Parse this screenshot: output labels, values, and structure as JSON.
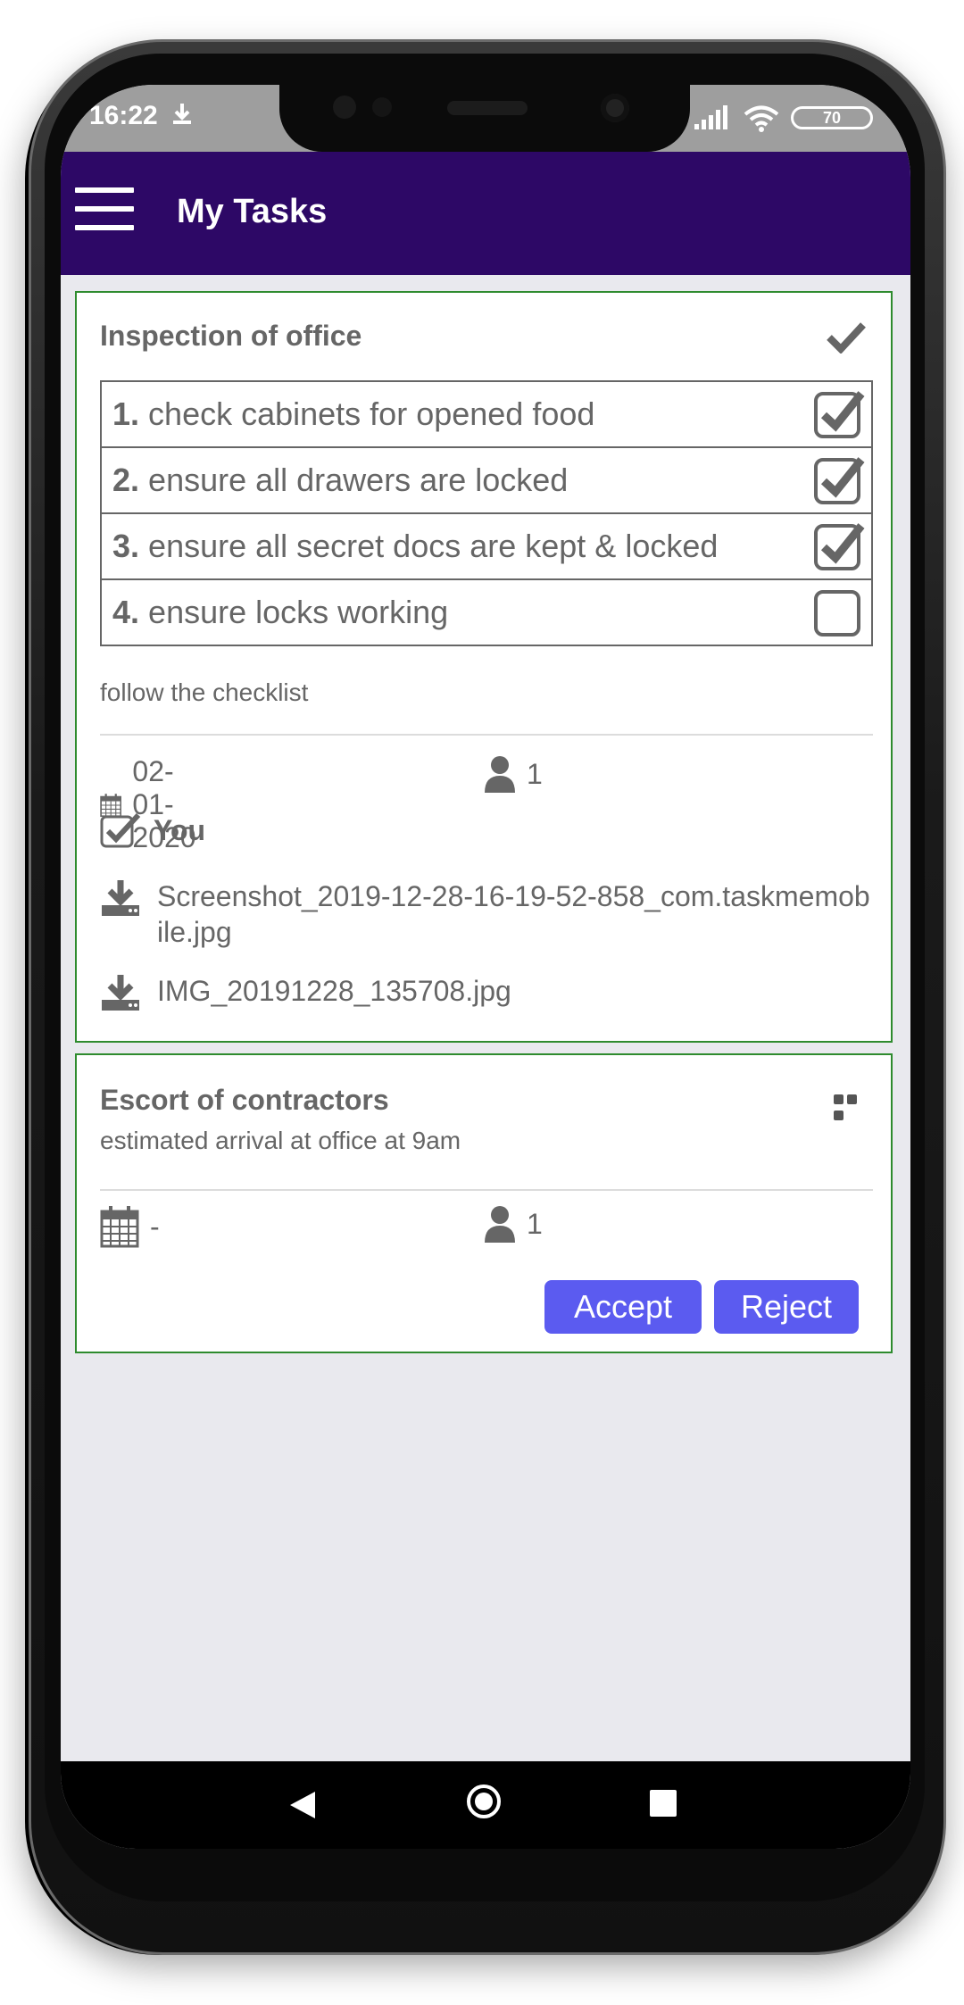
{
  "status_bar": {
    "time": "16:22",
    "battery": "70",
    "icons": [
      "download-icon",
      "signal-icon",
      "wifi-icon",
      "battery-icon"
    ]
  },
  "app_bar": {
    "title": "My Tasks",
    "background": "#2d0866"
  },
  "tasks": [
    {
      "title": "Inspection of office",
      "status_icon": "checkmark-icon",
      "checklist": [
        {
          "number": "1.",
          "text": "check cabinets for opened food",
          "checked": true
        },
        {
          "number": "2.",
          "text": "ensure all drawers are locked",
          "checked": true
        },
        {
          "number": "3.",
          "text": "ensure all secret docs are kept & locked",
          "checked": true
        },
        {
          "number": "4.",
          "text": "ensure locks working",
          "checked": false
        }
      ],
      "note": "follow the checklist",
      "date": "02-01-2020",
      "people": "1",
      "assignee": "You",
      "attachments": [
        {
          "name": "Screenshot_2019-12-28-16-19-52-858_com.taskmemobile.jpg"
        },
        {
          "name": "IMG_20191228_135708.jpg"
        }
      ],
      "border_color": "#2e8b2e"
    },
    {
      "title": "Escort of contractors",
      "status_icon": "more-icon",
      "description": "estimated arrival at office at 9am",
      "date": "-",
      "people": "1",
      "accept_label": "Accept",
      "reject_label": "Reject",
      "button_color": "#5b5bf0"
    }
  ]
}
